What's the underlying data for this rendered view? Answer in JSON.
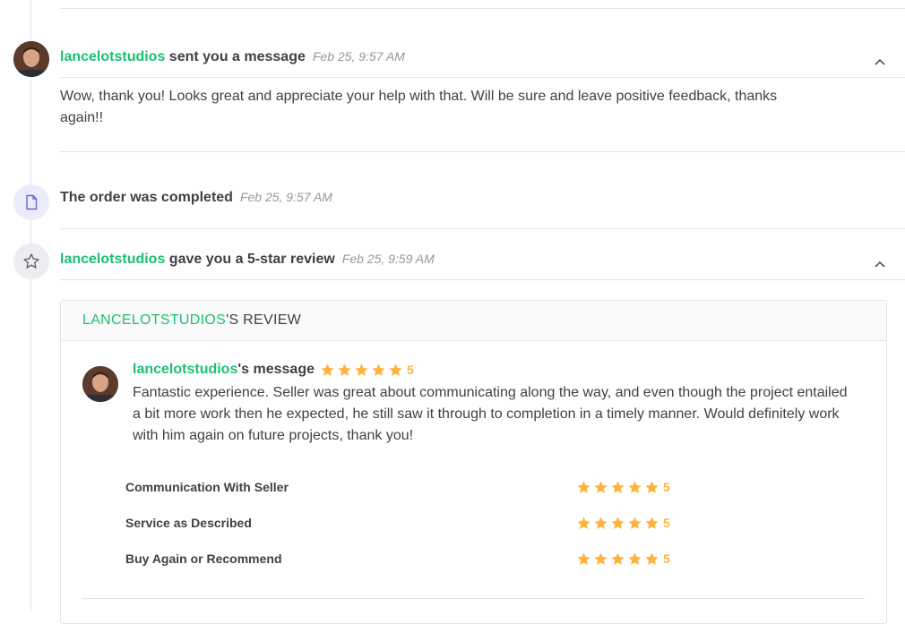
{
  "message_event": {
    "username": "lancelotstudios",
    "action": " sent you a message",
    "time": "Feb 25, 9:57 AM",
    "body": "Wow, thank you! Looks great and appreciate your help with that. Will be sure and leave positive feedback, thanks again!!"
  },
  "order_event": {
    "text": "The order was completed",
    "time": "Feb 25, 9:57 AM"
  },
  "review_event": {
    "username": "lancelotstudios",
    "action": " gave you a 5-star review",
    "time": "Feb 25, 9:59 AM"
  },
  "review_card": {
    "header_user": "LANCELOTSTUDIOS",
    "header_suffix": "'S REVIEW",
    "message_user": "lancelotstudios",
    "message_suffix": "'s message",
    "overall_rating": "5",
    "overall_rating_value": 5,
    "body": "Fantastic experience. Seller was great about communicating along the way, and even though the project entailed a bit more work then he expected, he still saw it through to completion in a timely manner. Would definitely work with him again on future projects, thank you!",
    "ratings": [
      {
        "label": "Communication With Seller",
        "value": "5"
      },
      {
        "label": "Service as Described",
        "value": "5"
      },
      {
        "label": "Buy Again or Recommend",
        "value": "5"
      }
    ]
  },
  "colors": {
    "accent_green": "#1dbf73",
    "star_yellow": "#ffb33e",
    "text_dark": "#404145",
    "text_muted": "#95979d"
  },
  "icons": {
    "order": "document-icon",
    "review": "star-outline-icon",
    "collapse": "chevron-up-icon"
  }
}
